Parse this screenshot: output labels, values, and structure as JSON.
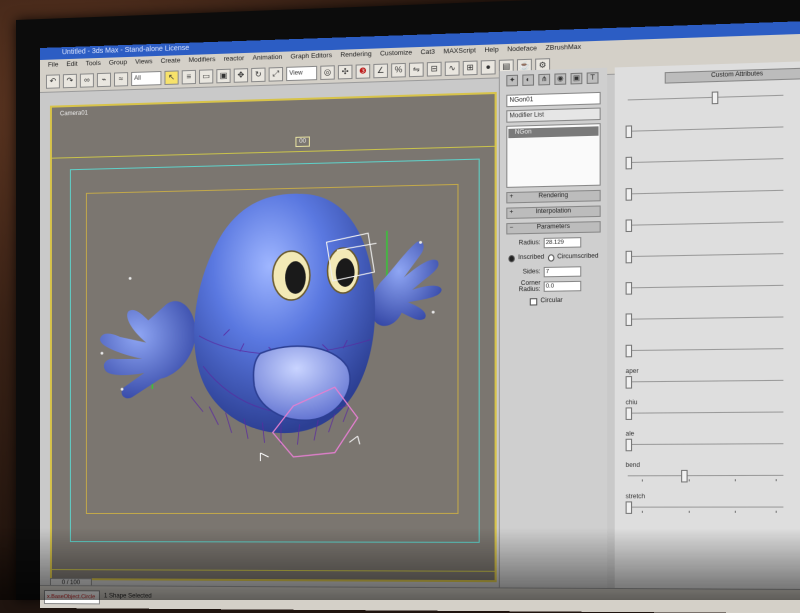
{
  "app": {
    "title": "Untitled - 3ds Max - Stand-alone License",
    "menus": [
      "File",
      "Edit",
      "Tools",
      "Group",
      "Views",
      "Create",
      "Modifiers",
      "reactor",
      "Animation",
      "Graph Editors",
      "Rendering",
      "Customize",
      "Cat3",
      "MAXScript",
      "Help",
      "Nodeface",
      "ZBrushMax"
    ],
    "toolbar": {
      "selection_filter": "All",
      "view_dropdown": "View"
    }
  },
  "viewport": {
    "label": "Camera01",
    "marker": "00",
    "frame_counter": "0 / 100"
  },
  "command_panel": {
    "object_name": "NGon01",
    "modifier_list": "Modifier List",
    "stack_item": "NGon",
    "rollouts": {
      "rendering": "Rendering",
      "interpolation": "Interpolation",
      "parameters": "Parameters"
    },
    "radius_label": "Radius:",
    "radius_value": "28.129",
    "inscribed_label": "Inscribed",
    "circumscribed_label": "Circumscribed",
    "sides_label": "Sides:",
    "sides_value": "7",
    "corner_radius_label": "Corner Radius:",
    "corner_radius_value": "0.0",
    "circular_label": "Circular"
  },
  "attributes": {
    "header": "Custom Attributes",
    "sliders": [
      {
        "name": "",
        "level": 0.55
      },
      {
        "name": "",
        "level": 0.0
      },
      {
        "name": "",
        "level": 0.0
      },
      {
        "name": "",
        "level": 0.0
      },
      {
        "name": "",
        "level": 0.0
      },
      {
        "name": "",
        "level": 0.0
      },
      {
        "name": "",
        "level": 0.0
      },
      {
        "name": "",
        "level": 0.0
      },
      {
        "name": "",
        "level": 0.0
      },
      {
        "name": "aper",
        "level": 0.0
      },
      {
        "name": "chiu",
        "level": 0.0
      },
      {
        "name": "ale",
        "level": 0.0
      },
      {
        "name": "bend",
        "level": 0.35
      },
      {
        "name": "stretch",
        "level": 0.0
      }
    ]
  },
  "statusbar": {
    "script_listener": "x.BaseObject.Circle",
    "selection_text": "1 Shape Selected"
  },
  "colors": {
    "viewport_bg": "#7b7670",
    "viewport_border": "#d7c34a",
    "character_body": "#5a78e0",
    "title_bar": "#2c5dc4"
  }
}
